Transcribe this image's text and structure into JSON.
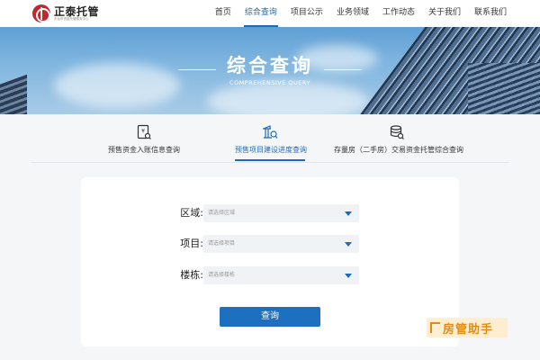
{
  "brand": {
    "name": "正泰托管",
    "tagline": "东台市资金托管服务中心"
  },
  "nav": {
    "items": [
      {
        "label": "首页",
        "active": false
      },
      {
        "label": "综合查询",
        "active": true
      },
      {
        "label": "项目公示",
        "active": false
      },
      {
        "label": "业务领域",
        "active": false
      },
      {
        "label": "工作动态",
        "active": false
      },
      {
        "label": "关于我们",
        "active": false
      },
      {
        "label": "联系我们",
        "active": false
      }
    ]
  },
  "banner": {
    "title": "综合查询",
    "subtitle": "COMPREHENSIVE QUERY"
  },
  "tabs": [
    {
      "label": "预售资金入账信息查询",
      "icon": "currency-receipt-icon",
      "active": false
    },
    {
      "label": "预售项目建设进度查询",
      "icon": "building-search-icon",
      "active": true
    },
    {
      "label": "存量房（二手房）交易资金托管综合查询",
      "icon": "database-search-icon",
      "active": false
    }
  ],
  "form": {
    "fields": [
      {
        "label": "区域:",
        "placeholder": "请选择区域"
      },
      {
        "label": "项目:",
        "placeholder": "请选择项目"
      },
      {
        "label": "楼栋:",
        "placeholder": "请选择楼栋"
      }
    ],
    "submit_label": "查询"
  },
  "watermark": {
    "text": "房管助手"
  },
  "colors": {
    "accent": "#1b6bb8",
    "brand_red": "#c0282d",
    "watermark_orange": "#e58a15"
  }
}
